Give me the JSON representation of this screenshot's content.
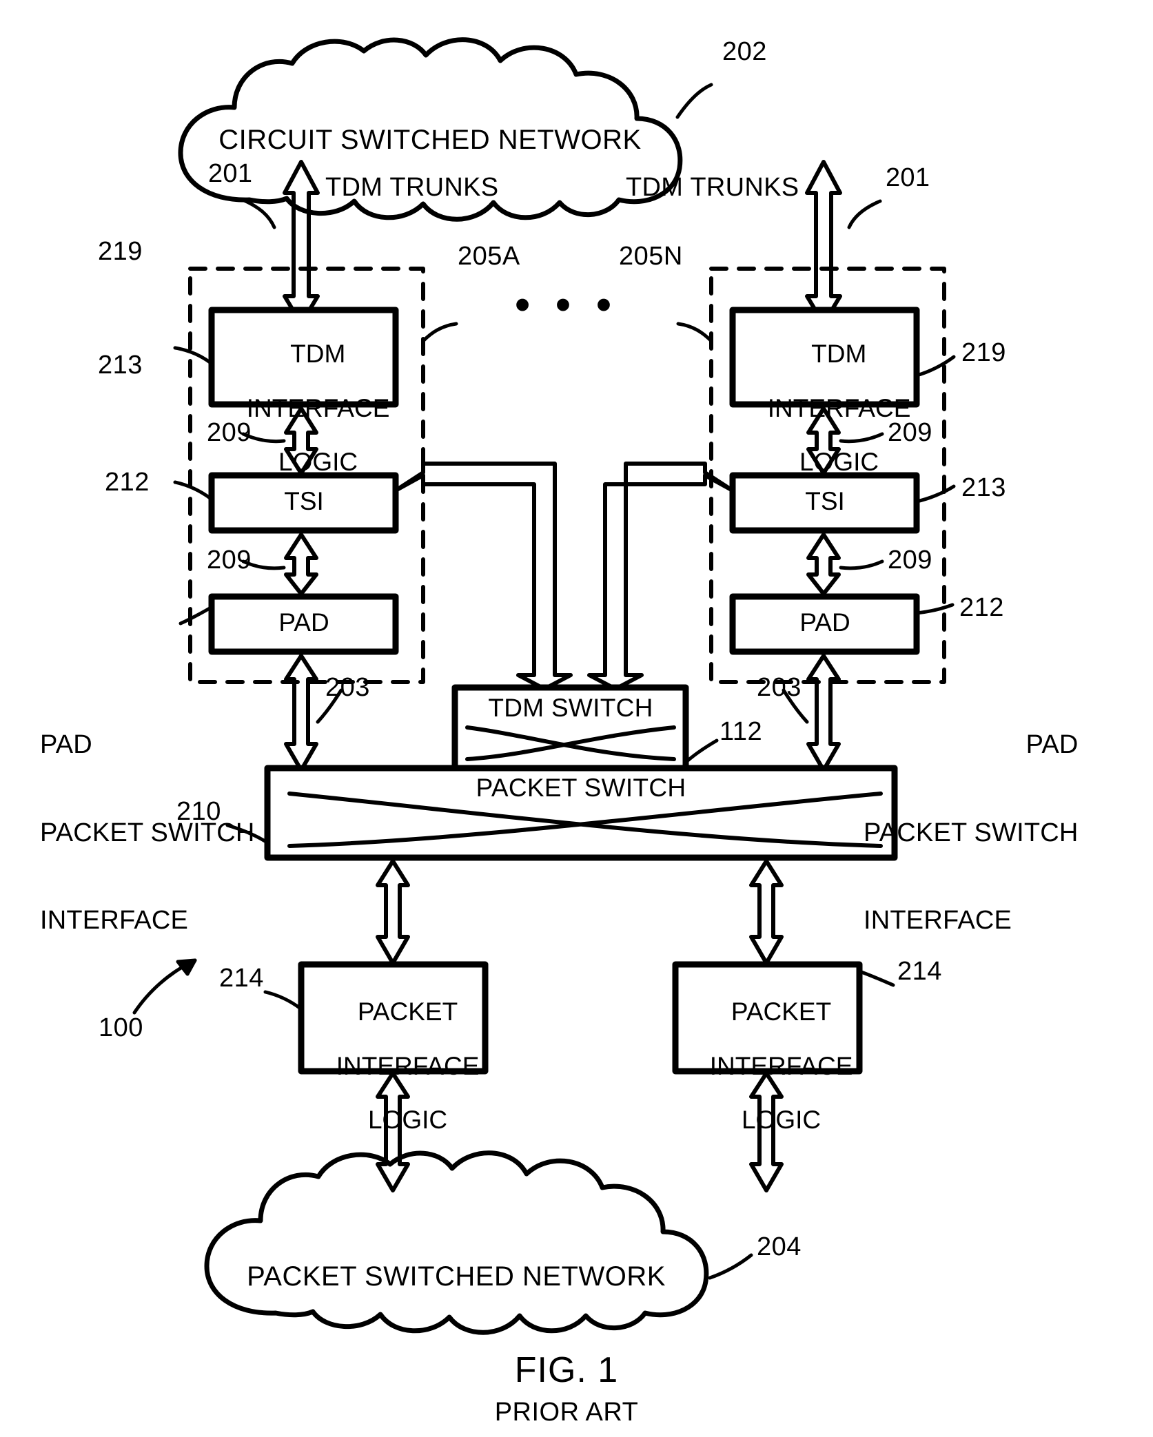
{
  "figure": {
    "caption": "FIG. 1",
    "subcaption": "PRIOR ART",
    "system_ref": "100"
  },
  "clouds": [
    {
      "id": "circuit-switched-network",
      "label": "CIRCUIT SWITCHED NETWORK",
      "ref": "202"
    },
    {
      "id": "packet-switched-network",
      "label": "PACKET SWITCHED NETWORK",
      "ref": "204"
    }
  ],
  "trunks": [
    {
      "label": "TDM TRUNKS",
      "ref": "201"
    },
    {
      "label": "TDM TRUNKS",
      "ref": "201"
    }
  ],
  "modules": [
    {
      "id": "module-a",
      "ref": "205A",
      "blocks": [
        {
          "id": "tdm-interface-logic-a",
          "label": "TDM\nINTERFACE\nLOGIC",
          "ref": "219"
        },
        {
          "id": "tsi-a",
          "label": "TSI",
          "ref": "213"
        },
        {
          "id": "pad-a",
          "label": "PAD",
          "ref": "212"
        }
      ],
      "links": [
        {
          "ref": "209"
        },
        {
          "ref": "209"
        }
      ],
      "downlink_ref": "203"
    },
    {
      "id": "module-n",
      "ref": "205N",
      "blocks": [
        {
          "id": "tdm-interface-logic-n",
          "label": "TDM\nINTERFACE\nLOGIC",
          "ref": "219"
        },
        {
          "id": "tsi-n",
          "label": "TSI",
          "ref": "213"
        },
        {
          "id": "pad-n",
          "label": "PAD",
          "ref": "212"
        }
      ],
      "links": [
        {
          "ref": "209"
        },
        {
          "ref": "209"
        }
      ],
      "downlink_ref": "203"
    }
  ],
  "ellipsis": "• • •",
  "side_notes": [
    {
      "id": "pad-packet-switch-interface-left",
      "line1": "PAD",
      "line2": "PACKET SWITCH",
      "line3": "INTERFACE"
    },
    {
      "id": "pad-packet-switch-interface-right",
      "line1": "PAD",
      "line2": "PACKET SWITCH",
      "line3": "INTERFACE"
    }
  ],
  "switches": [
    {
      "id": "tdm-switch",
      "label": "TDM SWITCH",
      "ref": "112"
    },
    {
      "id": "packet-switch",
      "label": "PACKET SWITCH",
      "ref": "210"
    }
  ],
  "packet_interfaces": [
    {
      "id": "packet-interface-logic-left",
      "label": "PACKET\nINTERFACE\nLOGIC",
      "ref": "214"
    },
    {
      "id": "packet-interface-logic-right",
      "label": "PACKET\nINTERFACE\nLOGIC",
      "ref": "214"
    }
  ],
  "colors": {
    "ink": "#000000",
    "paper": "#ffffff"
  }
}
